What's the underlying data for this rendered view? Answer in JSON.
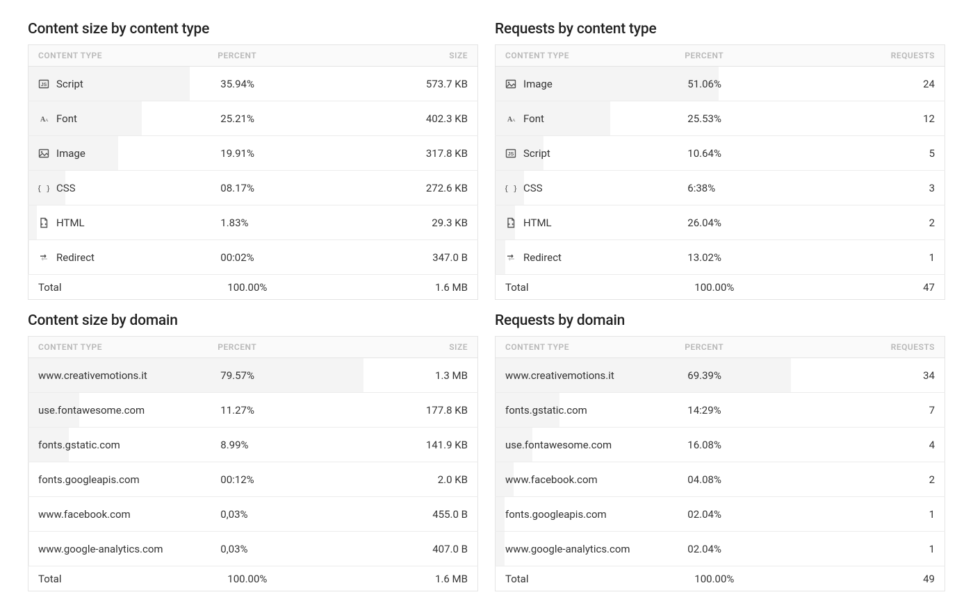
{
  "chart_data": [
    {
      "type": "table",
      "title": "Content size by content type",
      "columns": [
        "CONTENT TYPE",
        "PERCENT",
        "SIZE"
      ],
      "rows": [
        {
          "label": "Script",
          "percent": "35.94%",
          "value": "573.7 KB",
          "bar_pct": 35.94
        },
        {
          "label": "Font",
          "percent": "25.21%",
          "value": "402.3 KB",
          "bar_pct": 25.21
        },
        {
          "label": "Image",
          "percent": "19.91%",
          "value": "317.8 KB",
          "bar_pct": 19.91
        },
        {
          "label": "CSS",
          "percent": "08.17%",
          "value": "272.6 KB",
          "bar_pct": 8.17
        },
        {
          "label": "HTML",
          "percent": "1.83%",
          "value": "29.3 KB",
          "bar_pct": 1.83
        },
        {
          "label": "Redirect",
          "percent": "00:02%",
          "value": "347.0 B",
          "bar_pct": 0.02
        }
      ],
      "total": {
        "label": "Total",
        "percent": "100.00%",
        "value": "1.6 MB"
      }
    },
    {
      "type": "table",
      "title": "Requests by content type",
      "columns": [
        "CONTENT TYPE",
        "PERCENT",
        "REQUESTS"
      ],
      "rows": [
        {
          "label": "Image",
          "percent": "51.06%",
          "value": "24",
          "bar_pct": 51.06
        },
        {
          "label": "Font",
          "percent": "25.53%",
          "value": "12",
          "bar_pct": 25.53
        },
        {
          "label": "Script",
          "percent": "10.64%",
          "value": "5",
          "bar_pct": 10.64
        },
        {
          "label": "CSS",
          "percent": "6:38%",
          "value": "3",
          "bar_pct": 6.38
        },
        {
          "label": "HTML",
          "percent": "26.04%",
          "value": "2",
          "bar_pct": 4.26
        },
        {
          "label": "Redirect",
          "percent": "13.02%",
          "value": "1",
          "bar_pct": 2.13
        }
      ],
      "total": {
        "label": "Total",
        "percent": "100.00%",
        "value": "47"
      }
    },
    {
      "type": "table",
      "title": "Content size by domain",
      "columns": [
        "CONTENT TYPE",
        "PERCENT",
        "SIZE"
      ],
      "rows": [
        {
          "label": "www.creativemotions.it",
          "percent": "79.57%",
          "value": "1.3 MB",
          "bar_pct": 79.57
        },
        {
          "label": "use.fontawesome.com",
          "percent": "11.27%",
          "value": "177.8 KB",
          "bar_pct": 11.27
        },
        {
          "label": "fonts.gstatic.com",
          "percent": "8.99%",
          "value": "141.9 KB",
          "bar_pct": 8.99
        },
        {
          "label": "fonts.googleapis.com",
          "percent": "00:12%",
          "value": "2.0 KB",
          "bar_pct": 0.12
        },
        {
          "label": "www.facebook.com",
          "percent": "0,03%",
          "value": "455.0 B",
          "bar_pct": 0.03
        },
        {
          "label": "www.google-analytics.com",
          "percent": "0,03%",
          "value": "407.0 B",
          "bar_pct": 0.03
        }
      ],
      "total": {
        "label": "Total",
        "percent": "100.00%",
        "value": "1.6 MB"
      }
    },
    {
      "type": "table",
      "title": "Requests by domain",
      "columns": [
        "CONTENT TYPE",
        "PERCENT",
        "REQUESTS"
      ],
      "rows": [
        {
          "label": "www.creativemotions.it",
          "percent": "69.39%",
          "value": "34",
          "bar_pct": 69.39
        },
        {
          "label": "fonts.gstatic.com",
          "percent": "14:29%",
          "value": "7",
          "bar_pct": 14.29
        },
        {
          "label": "use.fontawesome.com",
          "percent": "16.08%",
          "value": "4",
          "bar_pct": 8.16
        },
        {
          "label": "www.facebook.com",
          "percent": "04.08%",
          "value": "2",
          "bar_pct": 4.08
        },
        {
          "label": "fonts.googleapis.com",
          "percent": "02.04%",
          "value": "1",
          "bar_pct": 2.04
        },
        {
          "label": "www.google-analytics.com",
          "percent": "02.04%",
          "value": "1",
          "bar_pct": 2.04
        }
      ],
      "total": {
        "label": "Total",
        "percent": "100.00%",
        "value": "49"
      }
    }
  ],
  "icons": {
    "Script": "<svg viewBox='0 0 16 16'><rect x='1.5' y='2.5' width='13' height='11' rx='1'/><text x='8' y='11' text-anchor='middle' font-size='7' font-family='Arial' fill='#555' stroke='none' font-weight='bold'>JS</text></svg>",
    "Font": "<svg viewBox='0 0 16 16'><text x='3' y='12' font-size='10' font-family='Georgia' fill='#555' stroke='none' font-weight='bold'>A</text><text x='10' y='12' font-size='6' font-family='Georgia' fill='#555' stroke='none'>A</text></svg>",
    "Image": "<svg viewBox='0 0 16 16'><rect x='1.5' y='2.5' width='13' height='11' rx='1'/><circle cx='5' cy='6' r='1.2' fill='#555' stroke='none'/><path d='M2 12 L6 8 L9 11 L12 8 L14 10'/></svg>",
    "CSS": "<svg viewBox='0 0 16 16'><text x='8' y='12' text-anchor='middle' font-size='11' font-family='monospace' fill='#555' stroke='none'>{ }</text></svg>",
    "HTML": "<svg viewBox='0 0 16 16'><path d='M4 1.5 H10 L12.5 4 V14.5 H4 Z'/><path d='M10 1.5 V4 H12.5'/><path d='M6 9 L5 10 L6 11 M10 9 L11 10 L10 11'/></svg>",
    "Redirect": "<svg viewBox='0 0 16 16'><path d='M3 6 H11 M11 6 L9 4 M11 6 L9 8'/><path d='M13 10 H5 M5 10 L7 8 M5 10 L7 12' opacity='0.35'/></svg>"
  }
}
